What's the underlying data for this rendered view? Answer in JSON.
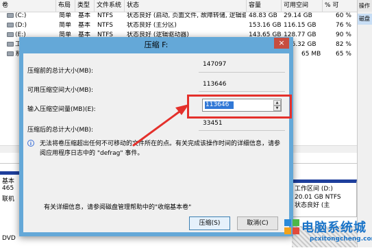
{
  "table": {
    "columns": [
      "卷",
      "布局",
      "类型",
      "文件系统",
      "状态",
      "容量",
      "可用空间",
      "% 可"
    ],
    "rows": [
      {
        "vol": "(C:)",
        "layout": "简单",
        "type": "基本",
        "fs": "NTFS",
        "status": "状态良好 (启动, 页面文件, 故障转储, 逻辑驱动器)",
        "cap": "48.83 GB",
        "free": "29.14 GB",
        "pct": "60 %"
      },
      {
        "vol": "(D:)",
        "layout": "简单",
        "type": "基本",
        "fs": "NTFS",
        "status": "状态良好 (主分区)",
        "cap": "153.16 GB",
        "free": "116.15 GB",
        "pct": "76 %"
      },
      {
        "vol": "(E:)",
        "layout": "简单",
        "type": "基本",
        "fs": "NTFS",
        "status": "状态良好 (逻辑驱动器)",
        "cap": "143.65 GB",
        "free": "128.77 GB",
        "pct": "90 %"
      },
      {
        "vol": "工",
        "layout": "",
        "type": "",
        "fs": "",
        "status": "",
        "cap": "",
        "free": "116.32 GB",
        "pct": "82 %"
      },
      {
        "vol": "系",
        "layout": "",
        "type": "",
        "fs": "",
        "status": "",
        "cap": "",
        "free": "65 MB",
        "pct": "65 %"
      }
    ]
  },
  "right_pane": {
    "header": "操作",
    "tab": "磁盘"
  },
  "lower": {
    "disk0_labels": [
      "基本",
      "465",
      "联机"
    ],
    "dvd_label": "DVD",
    "partition_d": {
      "line1": "工作区间 (D:)",
      "line2": "20.01 GB NTFS",
      "line3": "状态良好 (主"
    }
  },
  "dialog": {
    "title": "压缩 F:",
    "close_glyph": "×",
    "total_before_label": "压缩前的总计大小(MB):",
    "total_before_value": "147097",
    "available_label": "可用压缩空间大小(MB):",
    "available_value": "113646",
    "input_label": "输入压缩空间量(MB)(E):",
    "input_value": "113646",
    "total_after_label": "压缩后的总计大小(MB):",
    "total_after_value": "33451",
    "info_icon_glyph": "i",
    "info_text": "无法将卷压缩超出任何不可移动的文件所在的点。有关完成该操作时间的详细信息，请参阅应用程序日志中的 \"defrag\" 事件。",
    "help_text": "有关详细信息，请参阅磁盘管理帮助中的\"收缩基本卷\"",
    "shrink_button": "压缩(S)",
    "cancel_button": "取消(C)"
  },
  "watermark": {
    "title": "电脑系统城",
    "url": "pcxitongcheng.com"
  },
  "colors": {
    "dialog_frame": "#64a8d8",
    "annotation_red": "#e4302b",
    "selection_blue": "#3178d6",
    "watermark_blue": "#1a74c8"
  }
}
